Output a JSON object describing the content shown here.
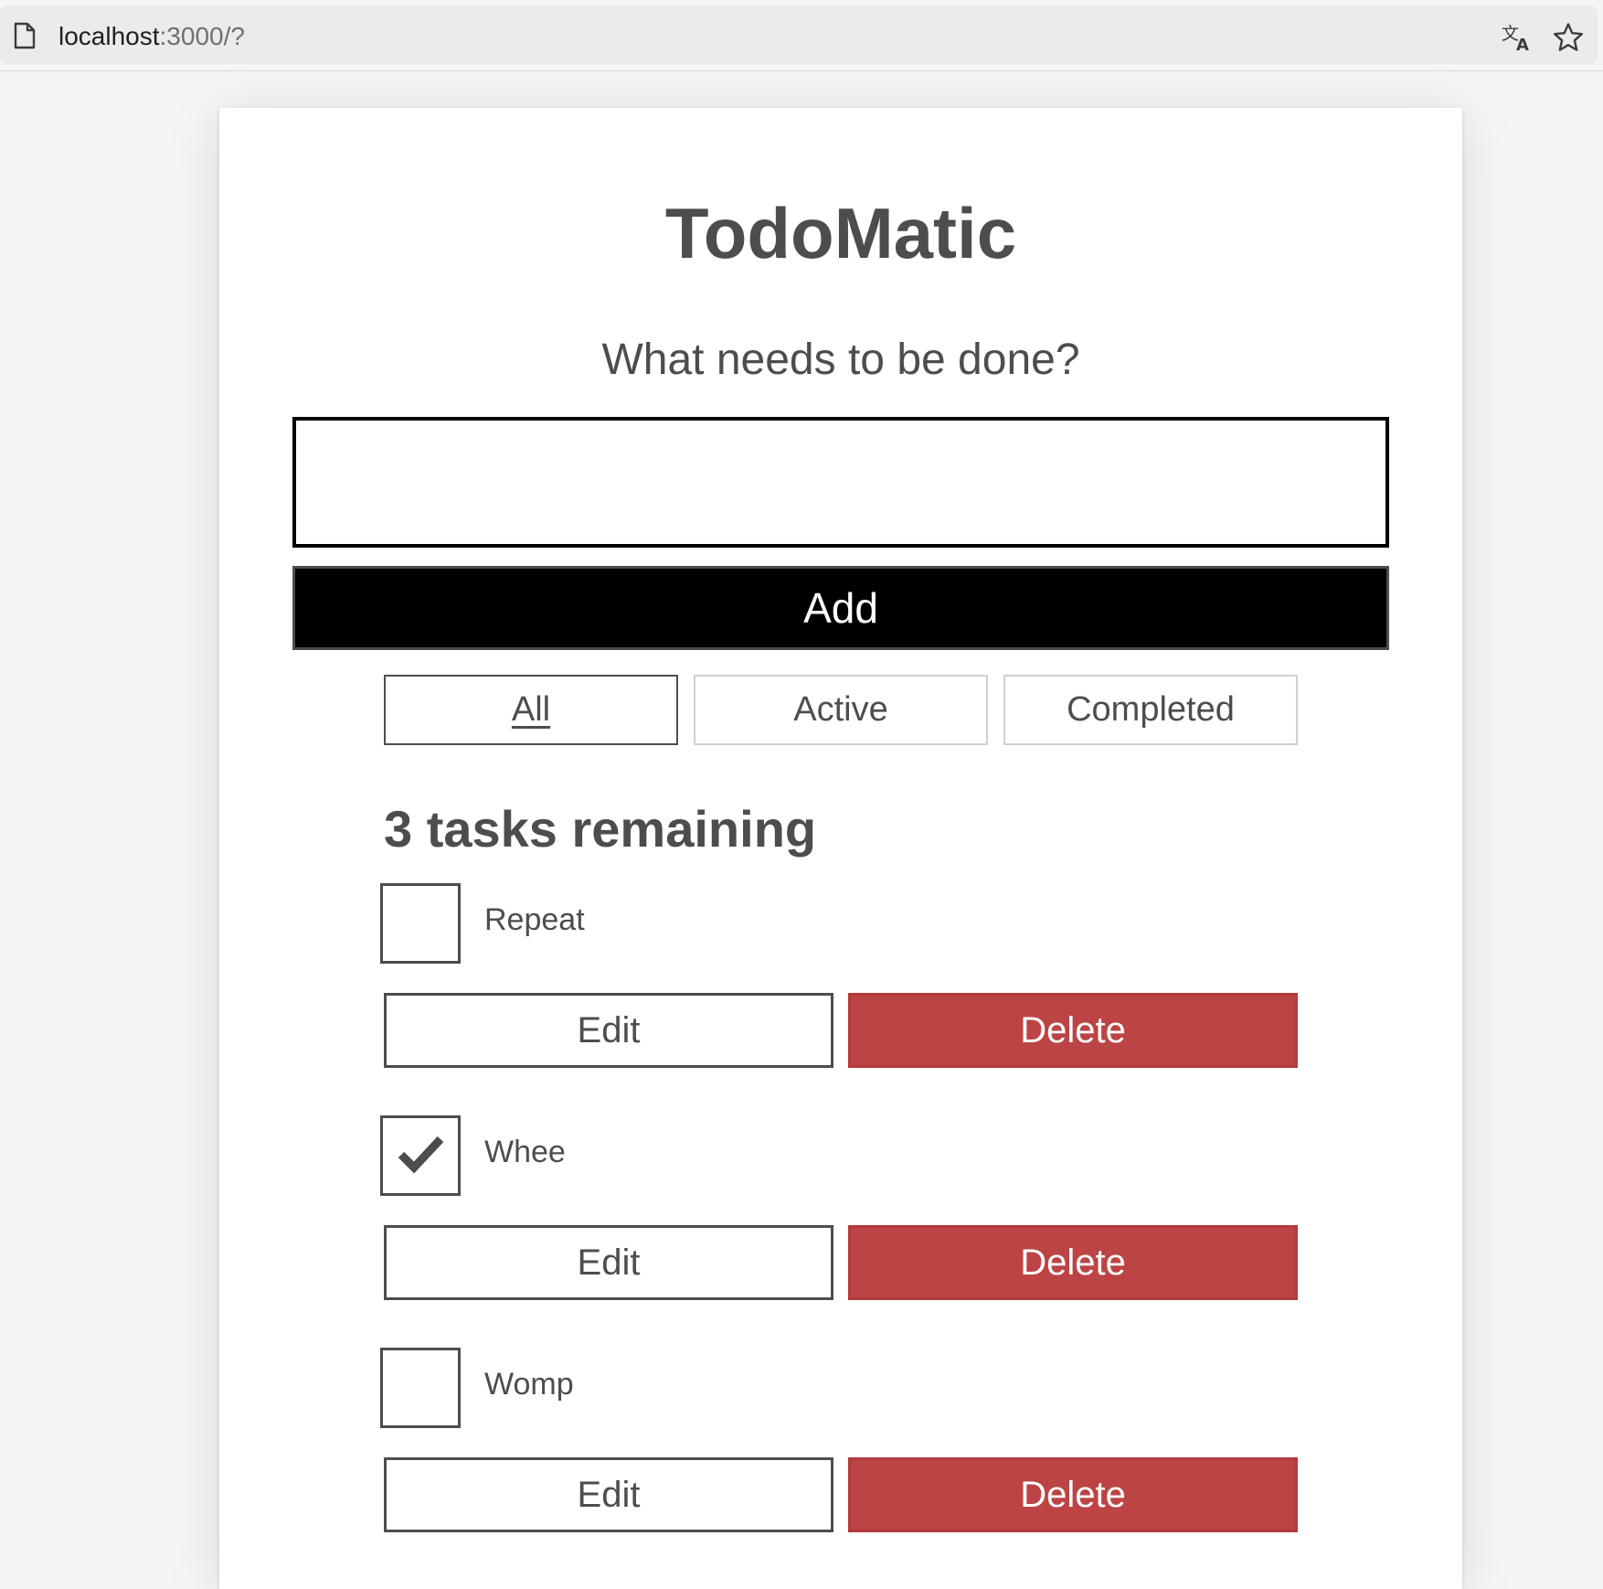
{
  "browser": {
    "url_host": "localhost",
    "url_rest": ":3000/?"
  },
  "app": {
    "title": "TodoMatic",
    "question": "What needs to be done?",
    "input_value": "",
    "add_label": "Add"
  },
  "filters": [
    {
      "label": "All",
      "pressed": true
    },
    {
      "label": "Active",
      "pressed": false
    },
    {
      "label": "Completed",
      "pressed": false
    }
  ],
  "remaining_heading": "3 tasks remaining",
  "todos": [
    {
      "label": "Repeat",
      "checked": false,
      "edit_label": "Edit",
      "delete_label": "Delete"
    },
    {
      "label": "Whee",
      "checked": true,
      "edit_label": "Edit",
      "delete_label": "Delete"
    },
    {
      "label": "Womp",
      "checked": false,
      "edit_label": "Edit",
      "delete_label": "Delete"
    }
  ],
  "colors": {
    "delete": "#bc4444",
    "text": "#4d4d4d",
    "add_bg": "#000000"
  }
}
